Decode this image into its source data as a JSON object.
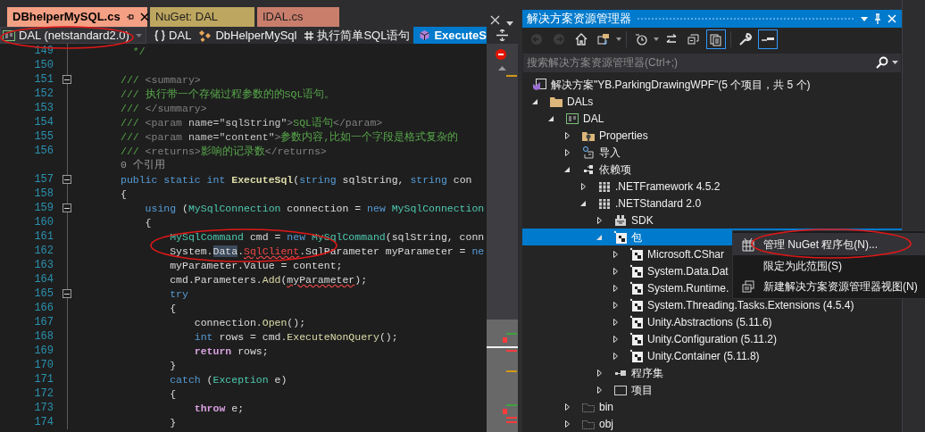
{
  "editor_tabs": [
    {
      "label": "DBhelperMySQL.cs",
      "selected": true,
      "color": "#f4a084"
    },
    {
      "label": "NuGet: DAL",
      "selected": false,
      "color": "#bda65f"
    },
    {
      "label": "IDAL.cs",
      "selected": false,
      "color": "#c97e6c"
    }
  ],
  "project_dropdown": {
    "text": "DAL (netstandard2.0)"
  },
  "navigation": [
    {
      "kind": "namespace",
      "text": "DAL",
      "selected": false
    },
    {
      "kind": "class",
      "text": "DbHelperMySql",
      "selected": false
    },
    {
      "kind": "region",
      "text": "执行简单SQL语句",
      "selected": false
    },
    {
      "kind": "method",
      "text": "ExecuteS",
      "selected": true
    }
  ],
  "code_lines": [
    {
      "kind": "code",
      "number": "149",
      "fold": false,
      "tokens": [
        {
          "kind": "comment",
          "text": "  */"
        }
      ]
    },
    {
      "kind": "code",
      "number": "150",
      "fold": false
    },
    {
      "kind": "code",
      "number": "151",
      "fold": true,
      "tokens": [
        {
          "kind": "comment",
          "text": "/// "
        },
        {
          "kind": "doctag",
          "text": "<summary>"
        }
      ]
    },
    {
      "kind": "code",
      "number": "152",
      "fold": false,
      "tokens": [
        {
          "kind": "comment",
          "text": "/// 执行带一个存储过程参数的的SQL语句。"
        }
      ]
    },
    {
      "kind": "code",
      "number": "153",
      "fold": false,
      "tokens": [
        {
          "kind": "comment",
          "text": "/// "
        },
        {
          "kind": "doctag",
          "text": "</summary>"
        }
      ]
    },
    {
      "kind": "code",
      "number": "154",
      "fold": false,
      "tokens": [
        {
          "kind": "comment",
          "text": "/// "
        },
        {
          "kind": "doctag",
          "text": "<param "
        },
        {
          "kind": "docattr",
          "text": "name="
        },
        {
          "kind": "docvalue",
          "text": "\"sqlString\""
        },
        {
          "kind": "doctag",
          "text": ">"
        },
        {
          "kind": "comment",
          "text": "SQL语句"
        },
        {
          "kind": "doctag",
          "text": "</param>"
        }
      ]
    },
    {
      "kind": "code",
      "number": "155",
      "fold": false,
      "tokens": [
        {
          "kind": "comment",
          "text": "/// "
        },
        {
          "kind": "doctag",
          "text": "<param "
        },
        {
          "kind": "docattr",
          "text": "name="
        },
        {
          "kind": "docvalue",
          "text": "\"content\""
        },
        {
          "kind": "doctag",
          "text": ">"
        },
        {
          "kind": "comment",
          "text": "参数内容,比如一个字段是格式复杂的"
        }
      ]
    },
    {
      "kind": "code",
      "number": "156",
      "fold": false,
      "tokens": [
        {
          "kind": "comment",
          "text": "/// "
        },
        {
          "kind": "doctag",
          "text": "<returns>"
        },
        {
          "kind": "comment",
          "text": "影响的记录数"
        },
        {
          "kind": "doctag",
          "text": "</returns>"
        }
      ]
    },
    {
      "kind": "lens",
      "text": "0 个引用"
    },
    {
      "kind": "code",
      "number": "157",
      "fold": true,
      "tokens": [
        {
          "kind": "keyword",
          "text": "public static int "
        },
        {
          "kind": "declaration",
          "text": "ExecuteSql"
        },
        {
          "kind": "plain",
          "text": "("
        },
        {
          "kind": "keyword",
          "text": "string"
        },
        {
          "kind": "plain",
          "text": " sqlString, "
        },
        {
          "kind": "keyword",
          "text": "string"
        },
        {
          "kind": "plain",
          "text": " con"
        }
      ]
    },
    {
      "kind": "code",
      "number": "158",
      "fold": false,
      "tokens": [
        {
          "kind": "plain",
          "text": "{"
        }
      ]
    },
    {
      "kind": "code",
      "number": "159",
      "fold": true,
      "tokens": [
        {
          "kind": "keyword",
          "text": "    using"
        },
        {
          "kind": "plain",
          "text": " ("
        },
        {
          "kind": "type",
          "text": "MySqlConnection"
        },
        {
          "kind": "plain",
          "text": " connection = "
        },
        {
          "kind": "keyword",
          "text": "new "
        },
        {
          "kind": "type",
          "text": "MySqlConnection"
        }
      ]
    },
    {
      "kind": "code",
      "number": "160",
      "fold": false,
      "tokens": [
        {
          "kind": "plain",
          "text": "    {"
        }
      ]
    },
    {
      "kind": "code",
      "number": "161",
      "fold": false,
      "tokens": [
        {
          "kind": "type",
          "text": "        MySqlCommand"
        },
        {
          "kind": "plain",
          "text": " cmd = "
        },
        {
          "kind": "keyword",
          "text": "new "
        },
        {
          "kind": "type",
          "text": "MySqlCommand"
        },
        {
          "kind": "plain",
          "text": "(sqlString, conn"
        }
      ]
    },
    {
      "kind": "code",
      "number": "162",
      "fold": false,
      "tokens": [
        {
          "kind": "plain",
          "text": "        System."
        },
        {
          "kind": "highlight",
          "text": "Data"
        },
        {
          "kind": "plain",
          "text": "."
        },
        {
          "kind": "error",
          "text": "SqlClient"
        },
        {
          "kind": "plain",
          "text": ".SqlParameter myParameter = "
        },
        {
          "kind": "keyword",
          "text": "ne"
        }
      ]
    },
    {
      "kind": "code",
      "number": "163",
      "fold": false,
      "tokens": [
        {
          "kind": "plain",
          "text": "        myParameter.Value = content;"
        }
      ]
    },
    {
      "kind": "code",
      "number": "164",
      "fold": false,
      "tokens": [
        {
          "kind": "plain",
          "text": "        cmd.Parameters."
        },
        {
          "kind": "method",
          "text": "Add"
        },
        {
          "kind": "plain",
          "text": "("
        },
        {
          "kind": "squiggle",
          "text": "myParameter"
        },
        {
          "kind": "plain",
          "text": ");"
        }
      ]
    },
    {
      "kind": "code",
      "number": "165",
      "fold": true,
      "tokens": [
        {
          "kind": "keyword",
          "text": "        try"
        }
      ]
    },
    {
      "kind": "code",
      "number": "166",
      "fold": false,
      "tokens": [
        {
          "kind": "plain",
          "text": "        {"
        }
      ]
    },
    {
      "kind": "code",
      "number": "167",
      "fold": false,
      "tokens": [
        {
          "kind": "plain",
          "text": "            connection."
        },
        {
          "kind": "method",
          "text": "Open"
        },
        {
          "kind": "plain",
          "text": "();"
        }
      ]
    },
    {
      "kind": "code",
      "number": "168",
      "fold": false,
      "tokens": [
        {
          "kind": "keyword",
          "text": "            int"
        },
        {
          "kind": "plain",
          "text": " rows = cmd."
        },
        {
          "kind": "method",
          "text": "ExecuteNonQuery"
        },
        {
          "kind": "plain",
          "text": "();"
        }
      ]
    },
    {
      "kind": "code",
      "number": "169",
      "fold": false,
      "tokens": [
        {
          "kind": "control",
          "text": "            return"
        },
        {
          "kind": "plain",
          "text": " rows;"
        }
      ]
    },
    {
      "kind": "code",
      "number": "170",
      "fold": false,
      "tokens": [
        {
          "kind": "plain",
          "text": "        }"
        }
      ]
    },
    {
      "kind": "code",
      "number": "171",
      "fold": false,
      "tokens": [
        {
          "kind": "keyword",
          "text": "        catch"
        },
        {
          "kind": "plain",
          "text": " ("
        },
        {
          "kind": "type",
          "text": "Exception"
        },
        {
          "kind": "plain",
          "text": " e)"
        }
      ]
    },
    {
      "kind": "code",
      "number": "172",
      "fold": false,
      "tokens": [
        {
          "kind": "plain",
          "text": "        {"
        }
      ]
    },
    {
      "kind": "code",
      "number": "173",
      "fold": false,
      "tokens": [
        {
          "kind": "control",
          "text": "            throw"
        },
        {
          "kind": "plain",
          "text": " e;"
        }
      ]
    },
    {
      "kind": "code",
      "number": "174",
      "fold": false,
      "tokens": [
        {
          "kind": "plain",
          "text": "        }"
        }
      ]
    }
  ],
  "solution_explorer": {
    "title": "解决方案资源管理器",
    "toolbar": [
      {
        "kind": "back",
        "disabled": true,
        "pressed": false
      },
      {
        "kind": "forward",
        "disabled": true,
        "pressed": false
      },
      {
        "kind": "home",
        "disabled": false,
        "pressed": false
      },
      {
        "kind": "switch-views",
        "disabled": false,
        "pressed": false
      },
      {
        "kind": "history",
        "disabled": false,
        "pressed": false
      },
      {
        "kind": "sync",
        "disabled": false,
        "pressed": false
      },
      {
        "kind": "collapse",
        "disabled": false,
        "pressed": false
      },
      {
        "kind": "show-all",
        "disabled": false,
        "pressed": true
      },
      {
        "kind": "properties",
        "disabled": false,
        "pressed": false
      },
      {
        "kind": "preview",
        "disabled": false,
        "pressed": true
      }
    ],
    "search": {
      "placeholder": "搜索解决方案资源管理器(Ctrl+;)"
    },
    "solution": {
      "label": "解决方案\"YB.ParkingDrawingWPF\"(5 个项目，共 5 个)"
    },
    "tree": [
      {
        "label": "DALs",
        "kind": "folder",
        "expanded": true,
        "selected": false,
        "children": [
          {
            "label": "DAL",
            "kind": "project",
            "expanded": true,
            "selected": false,
            "children": [
              {
                "label": "Properties",
                "kind": "properties",
                "expanded": false,
                "selected": false
              },
              {
                "label": "导入",
                "kind": "import",
                "expanded": false,
                "selected": false
              },
              {
                "label": "依赖项",
                "kind": "dependencies",
                "expanded": true,
                "selected": false,
                "children": [
                  {
                    "label": ".NETFramework 4.5.2",
                    "kind": "framework",
                    "expanded": false,
                    "selected": false
                  },
                  {
                    "label": ".NETStandard 2.0",
                    "kind": "framework",
                    "expanded": true,
                    "selected": false,
                    "children": [
                      {
                        "label": "SDK",
                        "kind": "sdk",
                        "expanded": false,
                        "selected": false
                      },
                      {
                        "label": "包",
                        "kind": "package",
                        "expanded": true,
                        "selected": true,
                        "children": [
                          {
                            "label": "Microsoft.CShar",
                            "kind": "package",
                            "expanded": false,
                            "selected": false
                          },
                          {
                            "label": "System.Data.Dat",
                            "kind": "package",
                            "expanded": false,
                            "selected": false
                          },
                          {
                            "label": "System.Runtime.",
                            "kind": "package",
                            "expanded": false,
                            "selected": false
                          },
                          {
                            "label": "System.Threading.Tasks.Extensions (4.5.4)",
                            "kind": "package",
                            "expanded": false,
                            "selected": false
                          },
                          {
                            "label": "Unity.Abstractions (5.11.6)",
                            "kind": "package",
                            "expanded": false,
                            "selected": false
                          },
                          {
                            "label": "Unity.Configuration (5.11.2)",
                            "kind": "package",
                            "expanded": false,
                            "selected": false
                          },
                          {
                            "label": "Unity.Container (5.11.8)",
                            "kind": "package",
                            "expanded": false,
                            "selected": false
                          }
                        ]
                      },
                      {
                        "label": "程序集",
                        "kind": "assembly",
                        "expanded": false,
                        "selected": false
                      },
                      {
                        "label": "项目",
                        "kind": "projects",
                        "expanded": false,
                        "selected": false
                      }
                    ]
                  }
                ]
              },
              {
                "label": "bin",
                "kind": "hidden-folder",
                "expanded": false,
                "selected": false
              },
              {
                "label": "obj",
                "kind": "hidden-folder",
                "expanded": false,
                "selected": false
              }
            ]
          }
        ]
      }
    ]
  },
  "context_menu": [
    {
      "label": "管理 NuGet 程序包(N)...",
      "kind": "package",
      "selected": true
    },
    {
      "label": "限定为此范围(S)",
      "kind": "plain",
      "selected": false
    },
    {
      "label": "新建解决方案资源管理器视图(N)",
      "kind": "new-view",
      "selected": false
    }
  ]
}
